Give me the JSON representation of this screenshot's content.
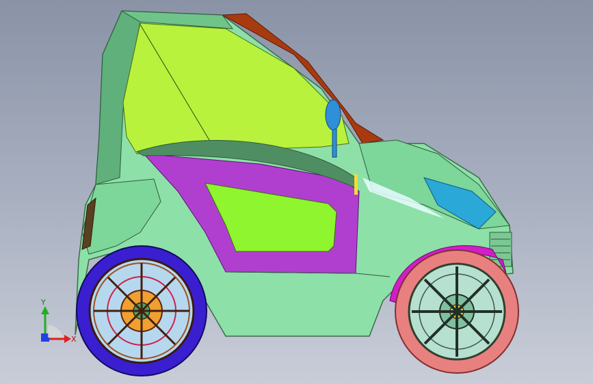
{
  "viewport": {
    "background_top": "#8a93a6",
    "background_bottom": "#c9cdd8"
  },
  "model": {
    "body_color": "#8de0a8",
    "body_shade": "#5fb07a",
    "windshield_color": "#b8f23c",
    "window_color": "#8ef52e",
    "door_panel_color": "#b03fd0",
    "roof_strip_color": "#a83a10",
    "front_tire_color": "#e98080",
    "rear_tire_color": "#3a1fd0",
    "fender_color": "#d21ec8",
    "headlight_color": "#2aa8d8",
    "mirror_color": "#2f8fd8"
  },
  "triad": {
    "x_label": "X",
    "y_label": "Y",
    "x_color": "#e02020",
    "y_color": "#20b020",
    "z_color": "#2040e0"
  }
}
